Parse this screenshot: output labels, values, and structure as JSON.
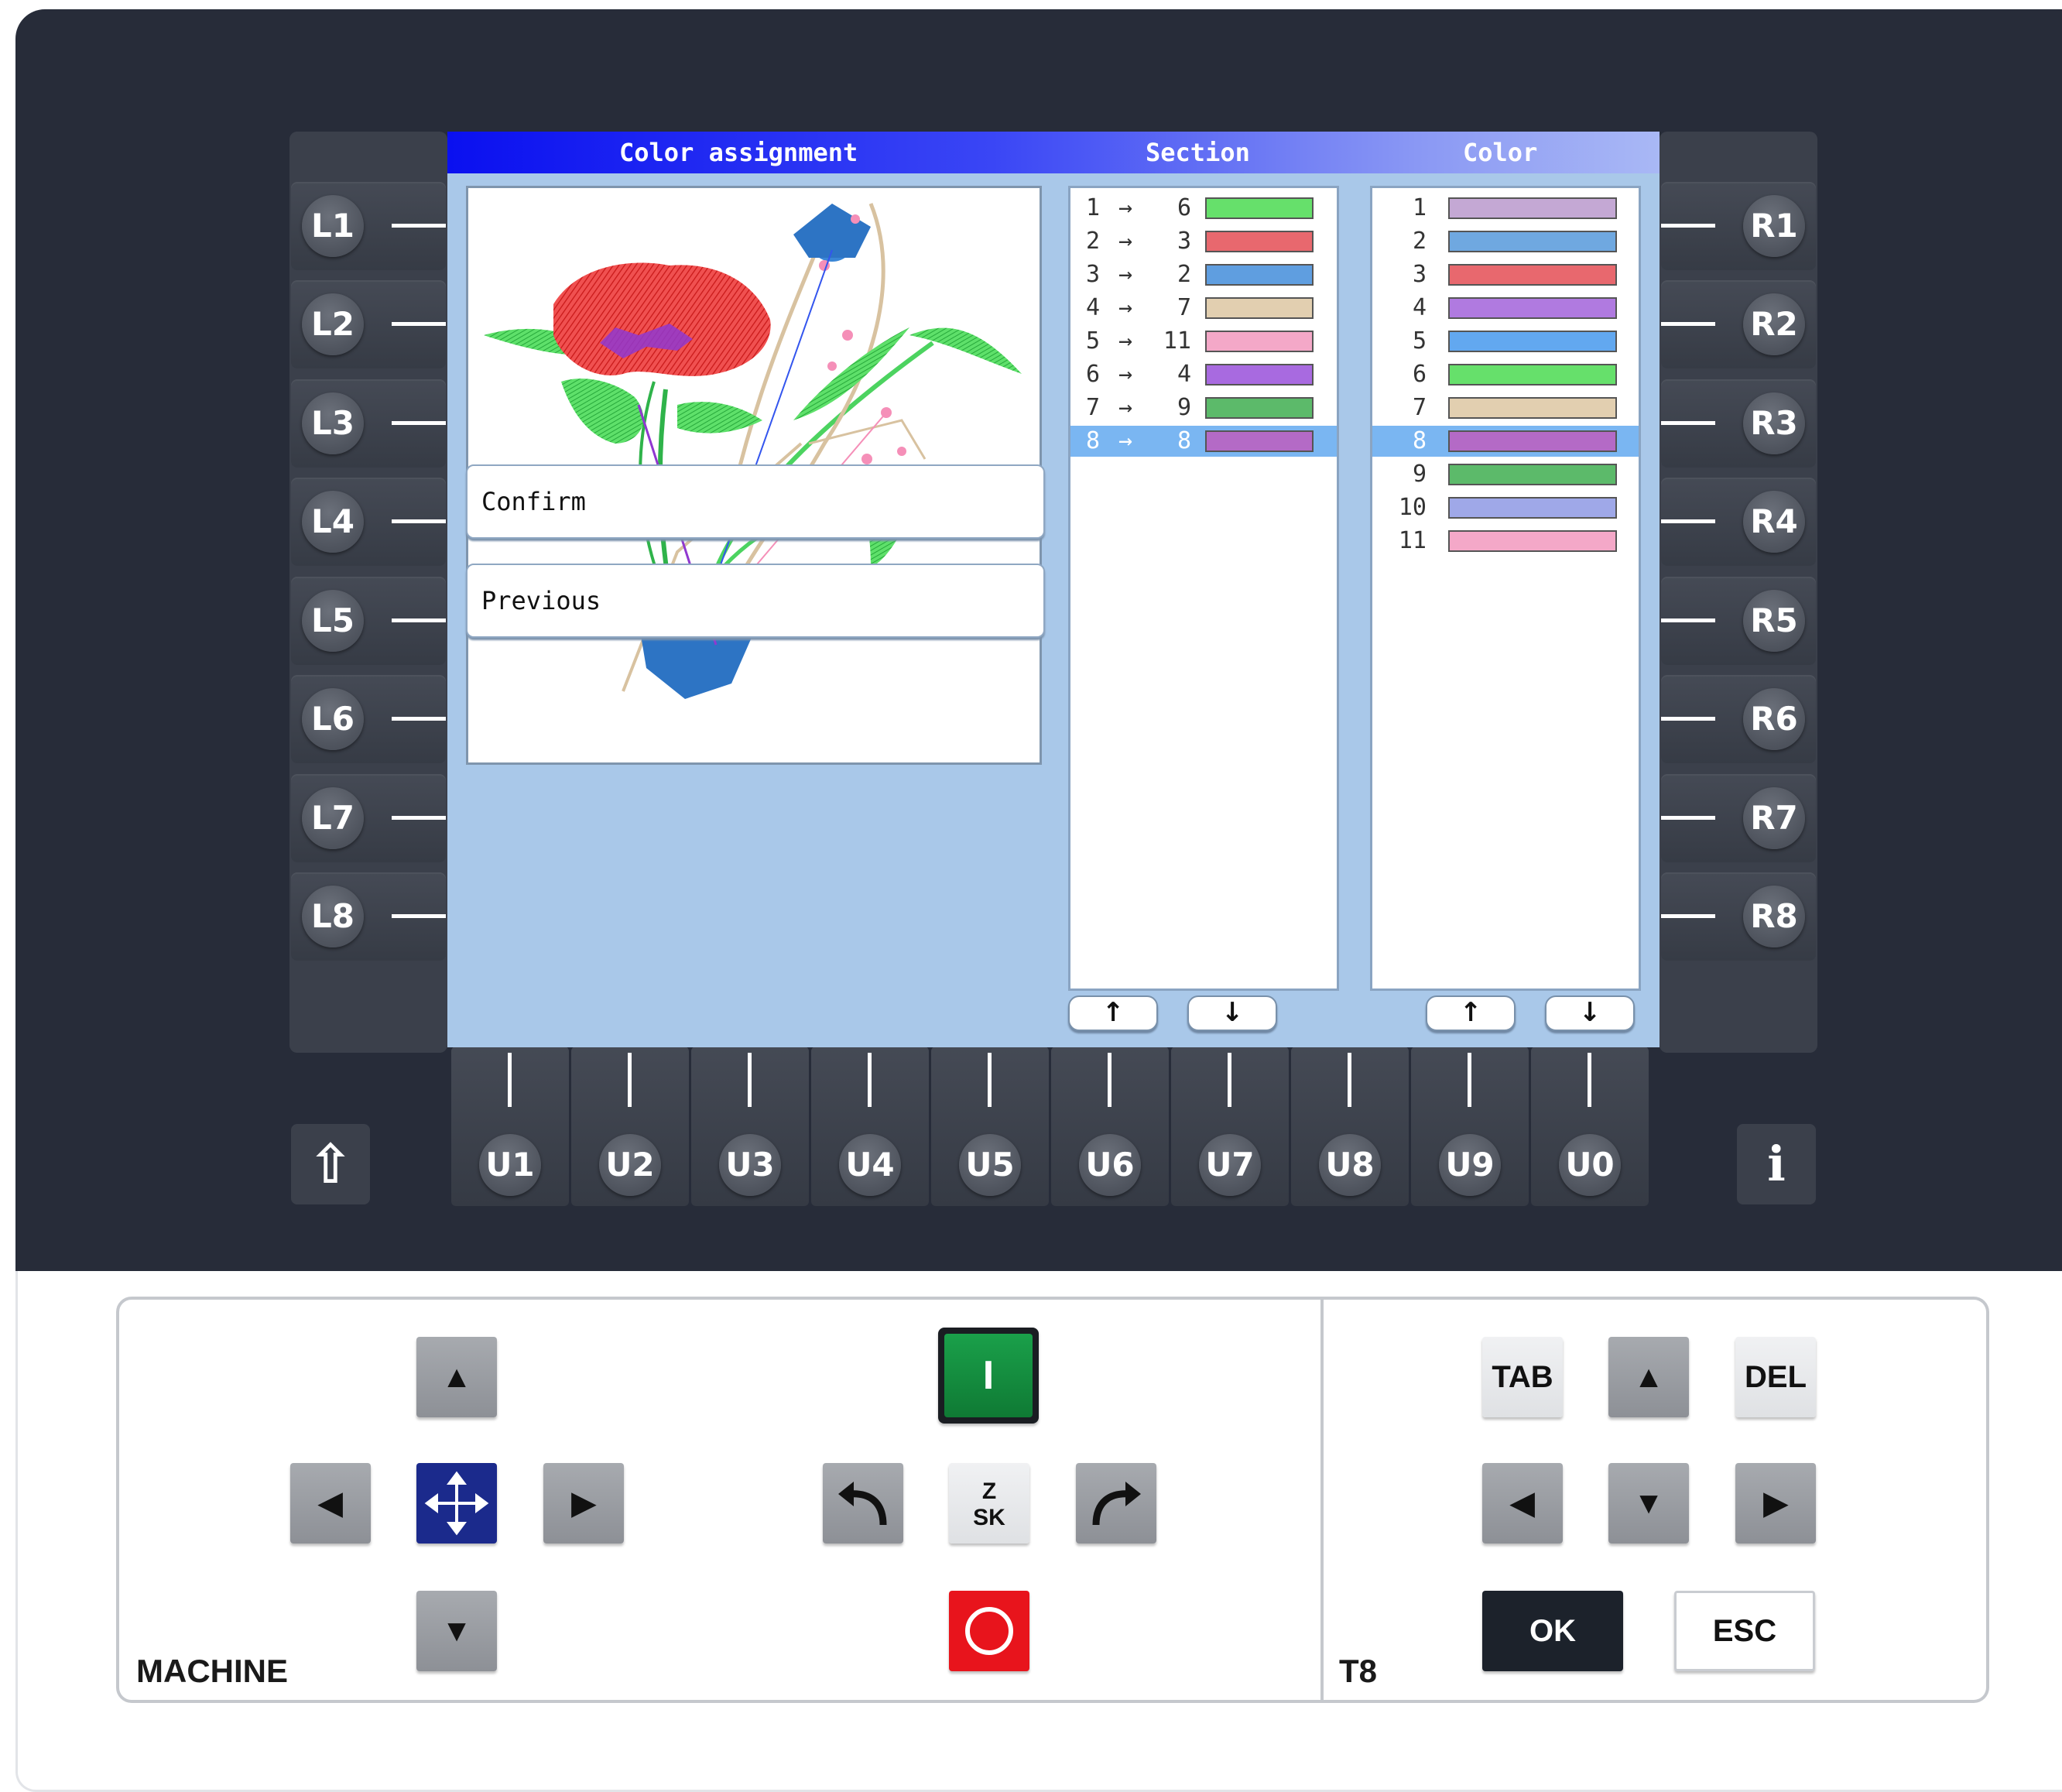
{
  "screen": {
    "title": "Color assignment",
    "section_header": "Section",
    "color_header": "Color",
    "buttons": {
      "confirm": "Confirm",
      "previous": "Previous"
    },
    "section_list": [
      {
        "from": "1",
        "arrow": "→",
        "to": "6",
        "color": "#66e06b"
      },
      {
        "from": "2",
        "arrow": "→",
        "to": "3",
        "color": "#e8686e"
      },
      {
        "from": "3",
        "arrow": "→",
        "to": "2",
        "color": "#5f9ee0"
      },
      {
        "from": "4",
        "arrow": "→",
        "to": "7",
        "color": "#e2cfb0"
      },
      {
        "from": "5",
        "arrow": "→",
        "to": "11",
        "color": "#f4a8c8"
      },
      {
        "from": "6",
        "arrow": "→",
        "to": "4",
        "color": "#a86ae0"
      },
      {
        "from": "7",
        "arrow": "→",
        "to": "9",
        "color": "#5cba6a"
      },
      {
        "from": "8",
        "arrow": "→",
        "to": "8",
        "color": "#b46ac6",
        "selected": true
      }
    ],
    "color_list": [
      {
        "num": "1",
        "color": "#c4a8d4"
      },
      {
        "num": "2",
        "color": "#6fa8e0"
      },
      {
        "num": "3",
        "color": "#e8686e"
      },
      {
        "num": "4",
        "color": "#b07ae0"
      },
      {
        "num": "5",
        "color": "#62a8f0"
      },
      {
        "num": "6",
        "color": "#66e06b"
      },
      {
        "num": "7",
        "color": "#e2cfb0"
      },
      {
        "num": "8",
        "color": "#b46ac6",
        "selected": true
      },
      {
        "num": "9",
        "color": "#5cba6a"
      },
      {
        "num": "10",
        "color": "#9fa8e8"
      },
      {
        "num": "11",
        "color": "#f4a8c8"
      }
    ],
    "scroll_up": "↑",
    "scroll_down": "↓"
  },
  "left_keys": [
    "L1",
    "L2",
    "L3",
    "L4",
    "L5",
    "L6",
    "L7",
    "L8"
  ],
  "right_keys": [
    "R1",
    "R2",
    "R3",
    "R4",
    "R5",
    "R6",
    "R7",
    "R8"
  ],
  "bottom_keys": [
    "U1",
    "U2",
    "U3",
    "U4",
    "U5",
    "U6",
    "U7",
    "U8",
    "U9",
    "U0"
  ],
  "shift_key": "⇧",
  "info_key": "i",
  "machine_panel": {
    "label": "MACHINE",
    "up": "▲",
    "down": "▼",
    "left": "◀",
    "right": "▶",
    "start": "I",
    "logo": "ZSK"
  },
  "t8_panel": {
    "label": "T8",
    "tab": "TAB",
    "del": "DEL",
    "up": "▲",
    "down": "▼",
    "left": "◀",
    "right": "▶",
    "ok": "OK",
    "esc": "ESC"
  },
  "colors": {
    "console": "#272c39",
    "title_blue": "#0a10f0",
    "screen_bg": "#a9c8e9",
    "selected_row": "#7ab6f2",
    "move_key": "#1a2a8f",
    "start_key": "#138a3a",
    "stop_key": "#e01b22"
  }
}
